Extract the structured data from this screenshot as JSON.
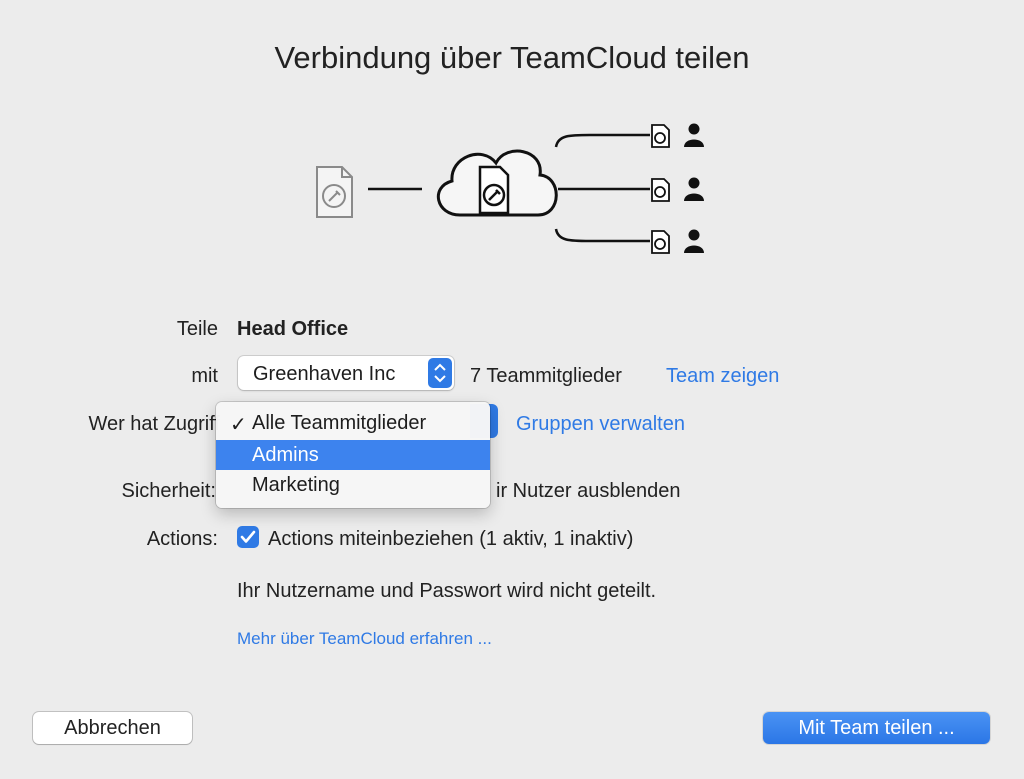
{
  "dialog": {
    "title": "Verbindung über TeamCloud teilen"
  },
  "form": {
    "share_label": "Teile",
    "share_value": "Head Office",
    "with_label": "mit",
    "team_select_value": "Greenhaven Inc",
    "team_count": "7 Teammitglieder",
    "show_team_link": "Team zeigen",
    "access_label": "Wer hat Zugriff",
    "manage_groups_link": "Gruppen verwalten",
    "security_label": "Sicherheit:",
    "security_text_visible": "ir Nutzer ausblenden",
    "actions_label": "Actions:",
    "actions_checkbox_label": "Actions miteinbeziehen (1 aktiv, 1 inaktiv)",
    "actions_checked": true,
    "info_text": "Ihr Nutzername und Passwort wird nicht geteilt.",
    "learn_more_link": "Mehr über TeamCloud erfahren ..."
  },
  "access_menu": {
    "items": [
      {
        "label": "Alle Teammitglieder",
        "checked": true,
        "highlighted": false
      },
      {
        "label": "Admins",
        "checked": false,
        "highlighted": true
      },
      {
        "label": "Marketing",
        "checked": false,
        "highlighted": false
      }
    ],
    "check_glyph": "✓"
  },
  "buttons": {
    "cancel": "Abbrechen",
    "share": "Mit Team teilen ..."
  },
  "colors": {
    "accent": "#2f7ae5",
    "menu_highlight": "#3d83ee",
    "background": "#ececec"
  }
}
